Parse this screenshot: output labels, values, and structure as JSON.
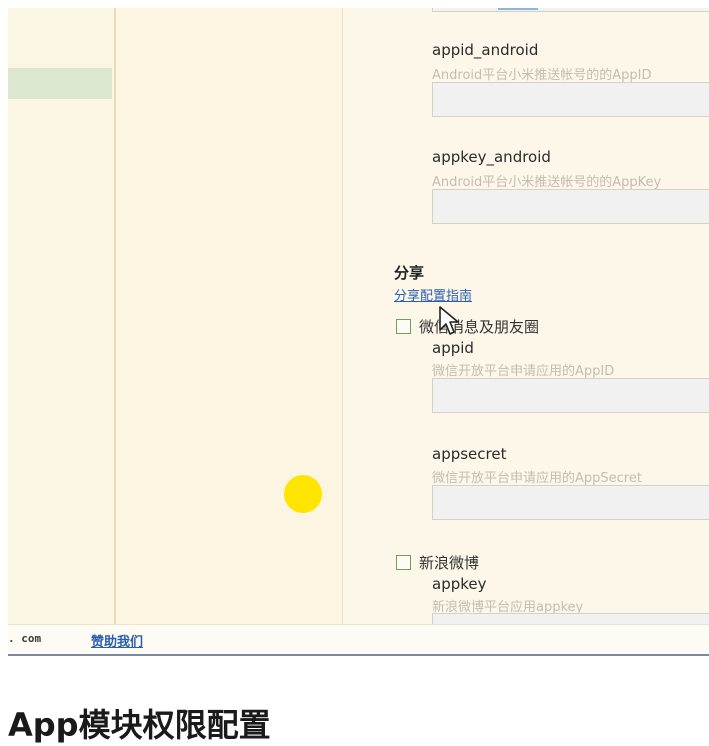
{
  "settings": {
    "fields": [
      {
        "label": "appid_android",
        "hint": "Android平台小米推送帐号的的AppID",
        "value": ""
      },
      {
        "label": "appkey_android",
        "hint": "Android平台小米推送帐号的的AppKey",
        "value": ""
      }
    ],
    "share_section": {
      "title": "分享",
      "guide_link": "分享配置指南",
      "wechat": {
        "checkbox_label": "微信消息及朋友圈",
        "checked": false,
        "fields": [
          {
            "label": "appid",
            "hint": "微信开放平台申请应用的AppID",
            "value": ""
          },
          {
            "label": "appsecret",
            "hint": "微信开放平台申请应用的AppSecret",
            "value": ""
          }
        ]
      },
      "weibo": {
        "checkbox_label": "新浪微博",
        "checked": false,
        "fields": [
          {
            "label": "appkey",
            "hint": "新浪微博平台应用appkey",
            "value": ""
          }
        ]
      }
    }
  },
  "footer": {
    "domain_fragment": ". com",
    "sponsor_link": "赞助我们"
  },
  "page_heading": "App模块权限配置",
  "colors": {
    "panel_bg": "#fcf6e6",
    "highlight": "#dbe8cf",
    "link": "#2a5fb0",
    "checkbox_border": "#6f9e5c",
    "cursor_dot": "#ffe400"
  },
  "icons": [
    "mouse-pointer-icon",
    "click-highlight-dot"
  ]
}
